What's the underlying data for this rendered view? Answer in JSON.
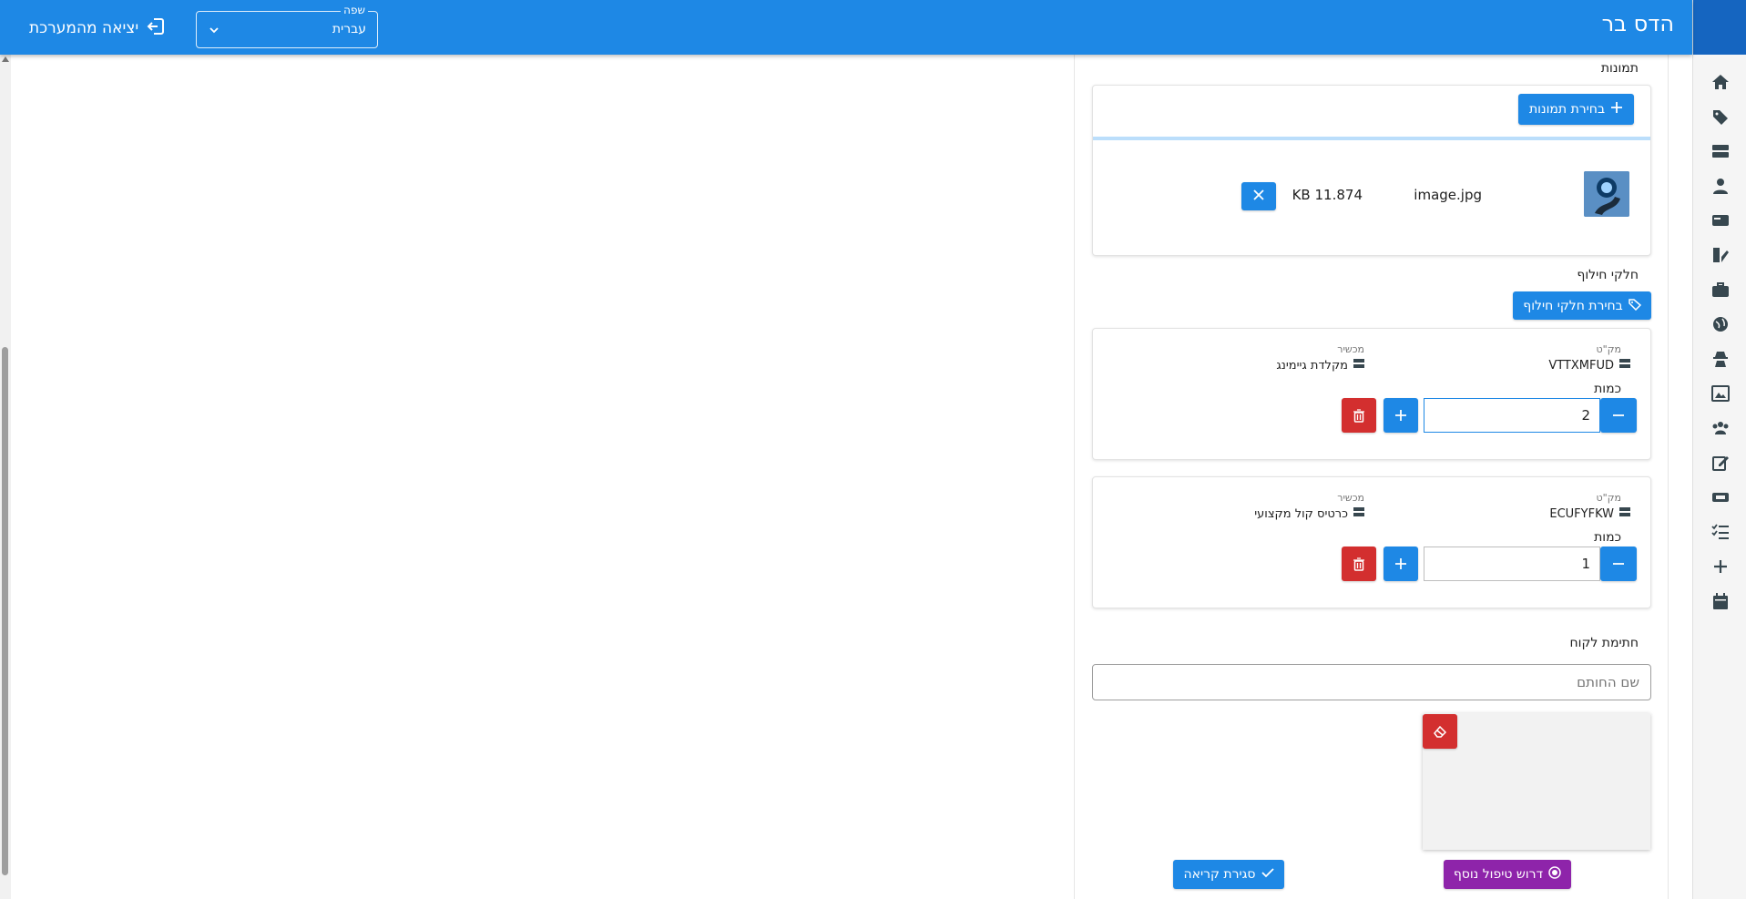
{
  "app": {
    "title": "הדס בר"
  },
  "header": {
    "language_label": "שפה",
    "language_value": "עברית",
    "logout_label": "יציאה מהמערכת"
  },
  "images_section": {
    "title": "תמונות",
    "choose_button": "בחירת תמונות",
    "files": [
      {
        "name": "image.jpg",
        "size": "11.874 KB"
      }
    ]
  },
  "parts_section": {
    "title": "חלקי חילוף",
    "choose_button": "בחירת חלקי חילוף",
    "sku_label": "מק\"ט",
    "device_label": "מכשיר",
    "quantity_label": "כמות",
    "items": [
      {
        "sku": "VTTXMFUD",
        "device": "מקלדת גיימינג",
        "quantity": "2"
      },
      {
        "sku": "ECUFYFKW",
        "device": "כרטיס קול מקצועי",
        "quantity": "1"
      }
    ]
  },
  "signature_section": {
    "title": "חתימת לקוח",
    "name_placeholder": "שם החותם"
  },
  "actions": {
    "require_more": "דרוש טיפול נוסף",
    "close_call": "סגירת קריאה"
  },
  "colors": {
    "primary": "#1e88e5",
    "danger": "#d32f2f",
    "accent_purple": "#8e24aa"
  },
  "rail_icons": [
    "home-icon",
    "tag-icon",
    "server-icon",
    "user-icon",
    "card-icon",
    "parts-icon",
    "toolbox-icon",
    "globe-icon",
    "spy-icon",
    "image-board-icon",
    "group-icon",
    "edit-icon",
    "ticket-icon",
    "checklist-icon",
    "plus-icon",
    "calendar-icon"
  ]
}
